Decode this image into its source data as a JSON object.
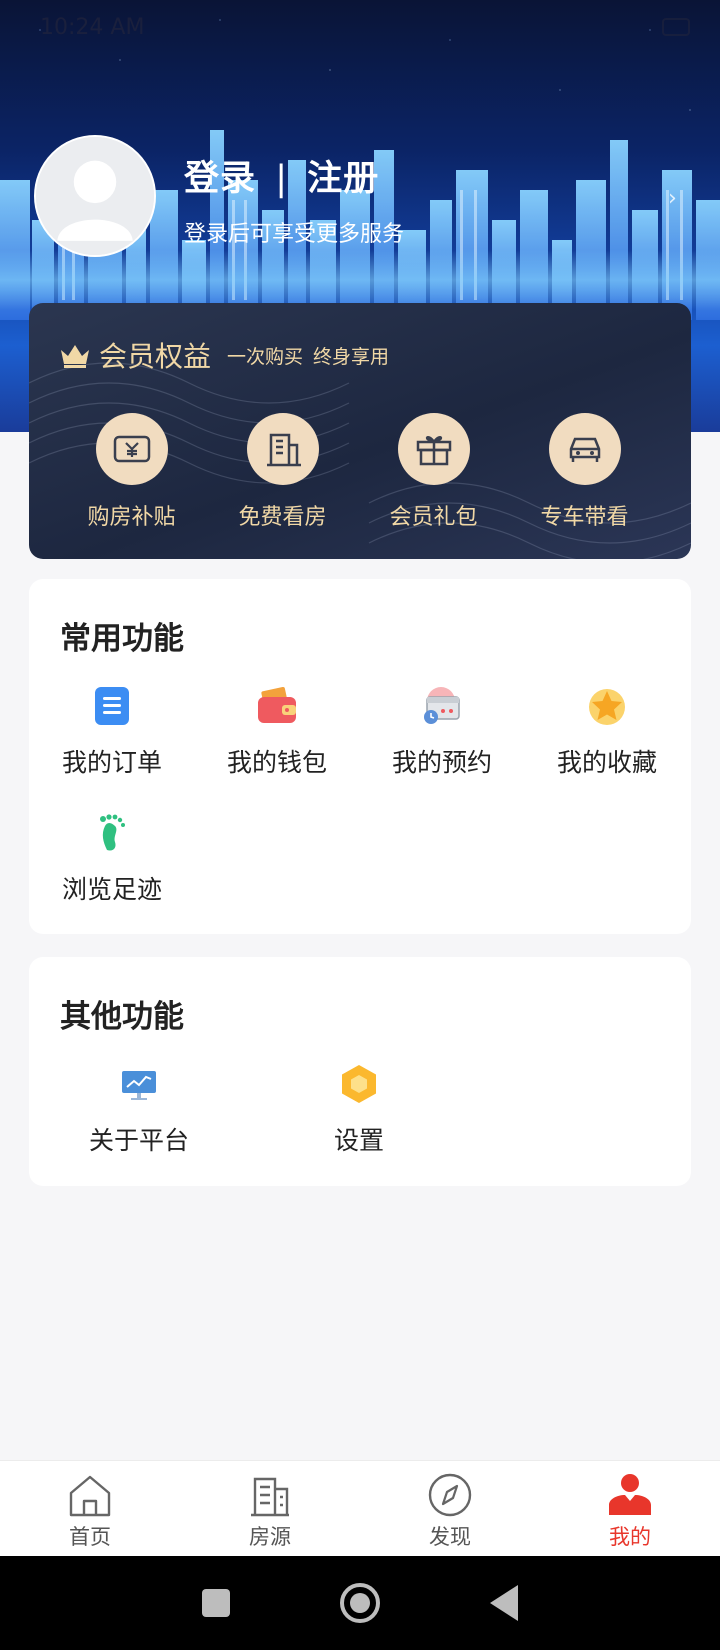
{
  "status_bar": {
    "time": "10:24 AM"
  },
  "profile": {
    "login_label": "登录",
    "divider": "|",
    "register_label": "注册",
    "subtitle": "登录后可享受更多服务"
  },
  "membership": {
    "title": "会员权益",
    "tag1": "一次购买",
    "tag2": "终身享用",
    "items": [
      {
        "label": "购房补贴",
        "icon": "yuan-ticket-icon"
      },
      {
        "label": "免费看房",
        "icon": "building-icon"
      },
      {
        "label": "会员礼包",
        "icon": "gift-icon"
      },
      {
        "label": "专车带看",
        "icon": "car-icon"
      }
    ]
  },
  "common": {
    "title": "常用功能",
    "items": [
      {
        "label": "我的订单",
        "icon": "order-list-icon"
      },
      {
        "label": "我的钱包",
        "icon": "wallet-icon"
      },
      {
        "label": "我的预约",
        "icon": "calendar-clock-icon"
      },
      {
        "label": "我的收藏",
        "icon": "star-icon"
      },
      {
        "label": "浏览足迹",
        "icon": "footprint-icon"
      }
    ]
  },
  "other": {
    "title": "其他功能",
    "items": [
      {
        "label": "关于平台",
        "icon": "monitor-icon"
      },
      {
        "label": "设置",
        "icon": "hexagon-settings-icon"
      }
    ]
  },
  "tabbar": {
    "items": [
      {
        "label": "首页",
        "icon": "home-icon",
        "active": false
      },
      {
        "label": "房源",
        "icon": "buildings-icon",
        "active": false
      },
      {
        "label": "发现",
        "icon": "compass-icon",
        "active": false
      },
      {
        "label": "我的",
        "icon": "user-icon",
        "active": true
      }
    ]
  },
  "colors": {
    "accent_red": "#e8362b",
    "gold": "#f1d8a6",
    "card_dark": "#1d2740"
  }
}
